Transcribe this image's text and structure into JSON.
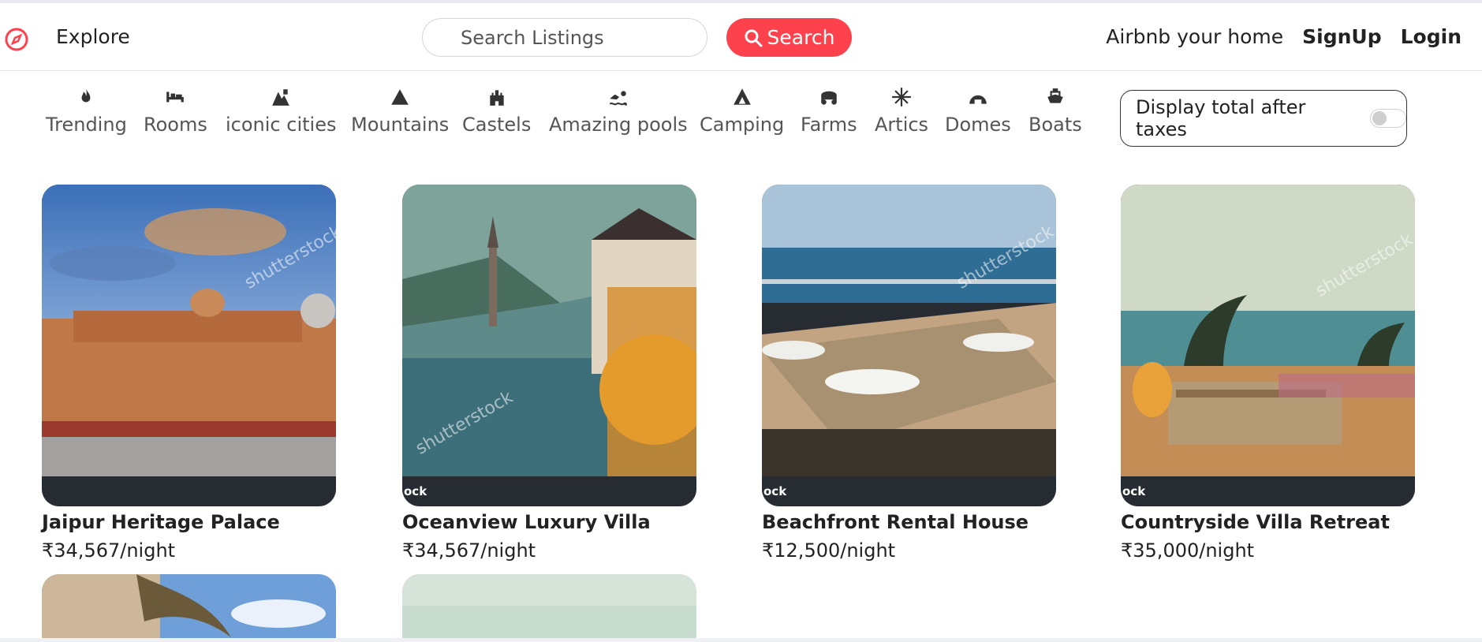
{
  "navbar": {
    "explore_label": "Explore",
    "search_placeholder": "Search Listings",
    "search_button_label": "Search",
    "host_link": "Airbnb your home",
    "signup_label": "SignUp",
    "login_label": "Login",
    "brand_color": "#fe424d"
  },
  "filters": [
    {
      "label": "Trending",
      "icon": "fire-icon"
    },
    {
      "label": "Rooms",
      "icon": "bed-icon"
    },
    {
      "label": "iconic cities",
      "icon": "city-icon"
    },
    {
      "label": "Mountains",
      "icon": "mountain-icon"
    },
    {
      "label": "Castels",
      "icon": "castle-icon"
    },
    {
      "label": "Amazing pools",
      "icon": "swimmer-icon"
    },
    {
      "label": "Camping",
      "icon": "tent-icon"
    },
    {
      "label": "Farms",
      "icon": "tractor-icon"
    },
    {
      "label": "Artics",
      "icon": "snowflake-icon"
    },
    {
      "label": "Domes",
      "icon": "igloo-icon"
    },
    {
      "label": "Boats",
      "icon": "ship-icon"
    }
  ],
  "tax_toggle": {
    "label": "Display total after taxes",
    "checked": false
  },
  "listings": [
    {
      "title": "Jaipur Heritage Palace",
      "price": "₹34,567/night",
      "watermark": "shutterstock",
      "strip_text": ""
    },
    {
      "title": "Oceanview Luxury Villa",
      "price": "₹34,567/night",
      "watermark": "shutterstock",
      "strip_text": "ock"
    },
    {
      "title": "Beachfront Rental House",
      "price": "₹12,500/night",
      "watermark": "shutterstock",
      "strip_text": "ock"
    },
    {
      "title": "Countryside Villa Retreat",
      "price": "₹35,000/night",
      "watermark": "shutterstock",
      "strip_text": "ock"
    }
  ]
}
